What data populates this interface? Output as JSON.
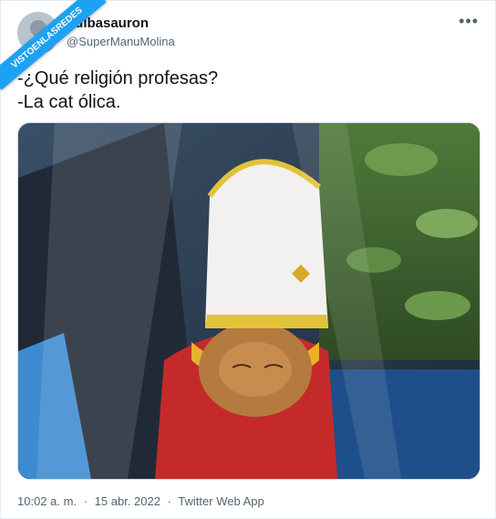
{
  "watermark": "VISTOENLASREDES",
  "tweet": {
    "display_name": "bulbasauron",
    "handle": "@SuperManuMolina",
    "more_icon": "more-horizontal-icon",
    "lines": [
      "-¿Qué religión profesas?",
      "-La cat ólica."
    ],
    "time": "10:02 a. m.",
    "sep": "·",
    "date": "15 abr. 2022",
    "source": "Twitter Web App"
  },
  "colors": {
    "accent": "#1da1f2",
    "text": "#0f1419",
    "muted": "#536471"
  }
}
